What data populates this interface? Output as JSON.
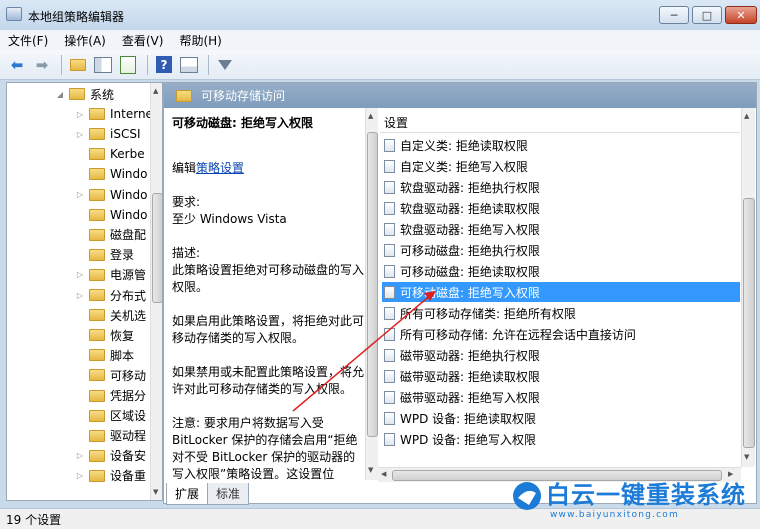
{
  "window": {
    "title": "本地组策略编辑器",
    "controls": {
      "minimize": "─",
      "maximize": "□",
      "close": "✕"
    }
  },
  "menu": [
    "文件(F)",
    "操作(A)",
    "查看(V)",
    "帮助(H)"
  ],
  "toolbar": {
    "icons": [
      "back-arrow-icon",
      "forward-arrow-icon",
      "up-folder-icon",
      "show-tree-icon",
      "export-icon",
      "help-icon",
      "properties-icon",
      "filter-icon"
    ],
    "help_glyph": "?"
  },
  "tree": {
    "items": [
      {
        "label": "系统",
        "expander": "expanded"
      },
      {
        "label": "Interne",
        "expander": "collapsed"
      },
      {
        "label": "iSCSI",
        "expander": "collapsed"
      },
      {
        "label": "Kerbe",
        "expander": "none"
      },
      {
        "label": "Windo",
        "expander": "none"
      },
      {
        "label": "Windo",
        "expander": "collapsed"
      },
      {
        "label": "Windo",
        "expander": "none"
      },
      {
        "label": "磁盘配",
        "expander": "none"
      },
      {
        "label": "登录",
        "expander": "none"
      },
      {
        "label": "电源管",
        "expander": "collapsed"
      },
      {
        "label": "分布式",
        "expander": "collapsed"
      },
      {
        "label": "关机选",
        "expander": "none"
      },
      {
        "label": "恢复",
        "expander": "none"
      },
      {
        "label": "脚本",
        "expander": "none"
      },
      {
        "label": "可移动",
        "expander": "none"
      },
      {
        "label": "凭据分",
        "expander": "none"
      },
      {
        "label": "区域设",
        "expander": "none"
      },
      {
        "label": "驱动程",
        "expander": "none"
      },
      {
        "label": "设备安",
        "expander": "collapsed"
      },
      {
        "label": "设备重",
        "expander": "collapsed"
      }
    ]
  },
  "panel": {
    "title": "可移动存储访问",
    "description": {
      "title": "可移动磁盘: 拒绝写入权限",
      "edit_prefix": "编辑",
      "edit_link": "策略设置",
      "req_label": "要求:",
      "req_value": "至少 Windows Vista",
      "desc_label": "描述:",
      "desc_text": "此策略设置拒绝对可移动磁盘的写入权限。",
      "enabled_text": "如果启用此策略设置，将拒绝对此可移动存储类的写入权限。",
      "disabled_text": "如果禁用或未配置此策略设置，将允许对此可移动存储类的写入权限。",
      "note_text": "注意: 要求用户将数据写入受 BitLocker 保护的存储会启用“拒绝对不受 BitLocker 保护的驱动器的写入权限”策略设置。这设置位"
    },
    "settings_header": "设置",
    "settings": [
      "自定义类: 拒绝读取权限",
      "自定义类: 拒绝写入权限",
      "软盘驱动器: 拒绝执行权限",
      "软盘驱动器: 拒绝读取权限",
      "软盘驱动器: 拒绝写入权限",
      "可移动磁盘: 拒绝执行权限",
      "可移动磁盘: 拒绝读取权限",
      "可移动磁盘: 拒绝写入权限",
      "所有可移动存储类: 拒绝所有权限",
      "所有可移动存储: 允许在远程会话中直接访问",
      "磁带驱动器: 拒绝执行权限",
      "磁带驱动器: 拒绝读取权限",
      "磁带驱动器: 拒绝写入权限",
      "WPD 设备: 拒绝读取权限",
      "WPD 设备: 拒绝写入权限"
    ],
    "selected_index": 7,
    "tabs": [
      "扩展",
      "标准"
    ]
  },
  "status": {
    "text": "19 个设置"
  },
  "watermark": {
    "brand": "白云一键重装系统",
    "url": "www.baiyunxitong.com"
  },
  "colors": {
    "selection": "#3399ff",
    "header": "#8aa6c4",
    "link": "#0b46b0",
    "annotation": "#e02020",
    "brand": "#1b7bd6"
  }
}
